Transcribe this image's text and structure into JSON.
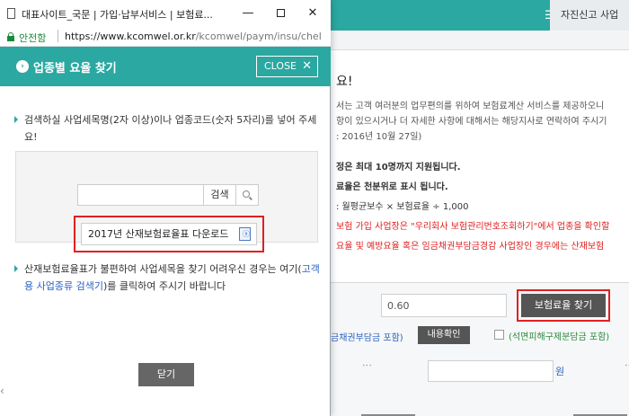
{
  "popup": {
    "window_title": "대표사이트_국문 | 가입·납부서비스 | 보험료...",
    "secure_label": "안전함",
    "url_host": "https://www.kcomwel.or.kr",
    "url_path": "/kcomwel/paym/insu/chel",
    "header_title": "업종별 요율 찾기",
    "close_label": "CLOSE",
    "instruction": "검색하실 사업세목명(2자 이상)이나 업종코드(숫자 5자리)를 넣어 주세요!",
    "search_placeholder": "",
    "search_button": "검색",
    "download_button": "2017년 산재보험료율표 다운로드",
    "note_before": "산재보험료율표가 불편하여 사업세목을 찾기 어려우신 경우는 여기(",
    "note_link": "고객용 사업종류 검색기",
    "note_after": ")를 클릭하여 주시기 바랍니다",
    "close_button": "닫기"
  },
  "background": {
    "tab_label": "자진신고 사업",
    "heading": "요!",
    "desc_lines": [
      "서는 고객 여러분의 업무편의를 위하여 보험료계산 서비스를 제공하오니",
      "항이 있으시거나 더 자세한 사항에 대해서는 해당지사로 연락하여 주시기",
      ": 2016년 10월 27일)"
    ],
    "rule1": "정은 최대 10명까지 지원됩니다.",
    "rule2": "료율은 천분위로 표시 됩니다.",
    "rule3": ": 월평균보수 × 보험료율 ÷ 1,000",
    "rule4": "보험 가입 사업장은 \"우리회사 보험관리번호조회하기\"에서 업종을 확인할",
    "rule5": "요율 및 예방요율 혹은 임금채권부담금경감 사업장인 경우에는 산재보험",
    "rate_value": "0.60",
    "find_rate_button": "보험료율 찾기",
    "incl_left": "금채권부담금 포함)",
    "confirm_button": "내용확인",
    "incl_right": "(석면피해구제분담금 포함)",
    "won_label": "원"
  }
}
